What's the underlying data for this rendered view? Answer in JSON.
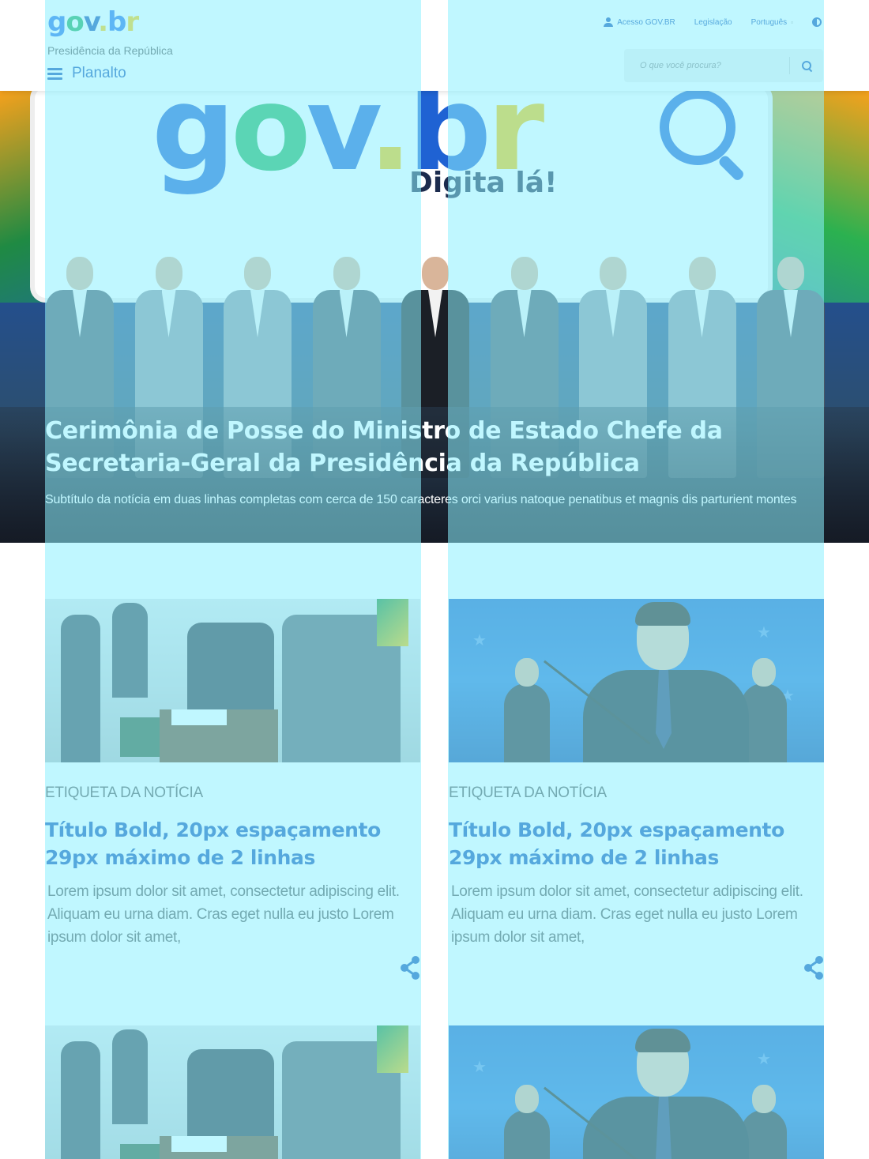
{
  "header": {
    "logo": {
      "g": "g",
      "o": "o",
      "v": "v",
      "dot": ".",
      "b": "b",
      "r": "r"
    },
    "organization": "Presidência da República",
    "menu_label": "Planalto",
    "links": {
      "access": "Acesso GOV.BR",
      "legislation": "Legislação",
      "language": "Português",
      "language_caret": "▫"
    },
    "search": {
      "placeholder": "O que você procura?"
    }
  },
  "hero": {
    "banner_wordmark": {
      "g": "g",
      "o": "o",
      "v": "v",
      "dot": ".",
      "b": "b",
      "r": "r"
    },
    "banner_tagline": "Digita lá!",
    "title": "Cerimônia de Posse do Ministro de Estado Chefe da Secretaria-Geral da Presidência da República",
    "subtitle": "Subtítulo da notícia em duas linhas completas com cerca de 150 caracteres orci varius natoque penatibus et magnis dis parturient montes"
  },
  "cards": [
    {
      "tag": "ETIQUETA DA NOTÍCIA",
      "title": "Título Bold, 20px espaçamento 29px máximo de 2 linhas",
      "desc": "Lorem ipsum dolor sit amet, consectetur adipiscing elit. Aliquam eu urna diam. Cras eget nulla eu justo Lorem ipsum dolor sit amet,"
    },
    {
      "tag": "ETIQUETA DA NOTÍCIA",
      "title": "Título Bold, 20px espaçamento 29px máximo de 2 linhas",
      "desc": "Lorem ipsum dolor sit amet, consectetur adipiscing elit. Aliquam eu urna diam. Cras eget nulla eu justo Lorem ipsum dolor sit amet,"
    }
  ],
  "colors": {
    "primary_blue": "#1351b4",
    "gov_green": "#1aae5c",
    "gov_yellow": "#ffcd07",
    "overlay_tint": "#8cf0ff"
  },
  "icons": [
    "menu-icon",
    "user-icon",
    "contrast-icon",
    "search-icon",
    "share-icon"
  ]
}
